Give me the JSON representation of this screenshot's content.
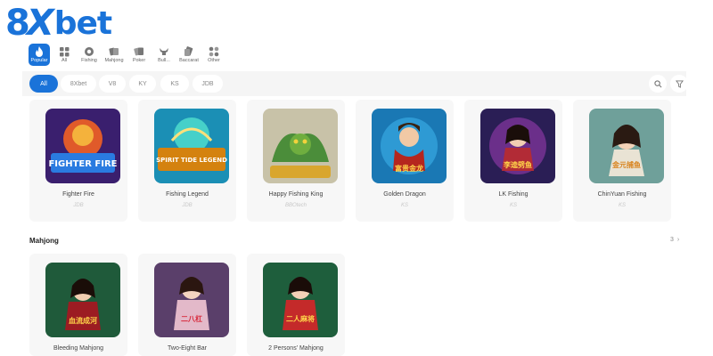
{
  "brand": {
    "logo_text_8": "8",
    "logo_text_x": "X",
    "logo_text_bet": "bet",
    "color": "#1a73d9"
  },
  "categories": [
    {
      "label": "Popular",
      "icon": "flame-icon",
      "active": true
    },
    {
      "label": "All",
      "icon": "grid-icon"
    },
    {
      "label": "Fishing",
      "icon": "fish-icon"
    },
    {
      "label": "Mahjong",
      "icon": "mahjong-icon"
    },
    {
      "label": "Poker",
      "icon": "cards-icon"
    },
    {
      "label": "Bull...",
      "icon": "bull-icon"
    },
    {
      "label": "Baccarat",
      "icon": "baccarat-icon"
    },
    {
      "label": "Other",
      "icon": "dots-icon"
    }
  ],
  "providers": [
    "All",
    "8Xbet",
    "V8",
    "KY",
    "KS",
    "JDB"
  ],
  "fishing_games": [
    {
      "name": "Fighter Fire",
      "provider": "JDB",
      "thumb_text": "FIGHTER FIRE"
    },
    {
      "name": "Fishing Legend",
      "provider": "JDB",
      "thumb_text": "SPIRIT TIDE LEGEND"
    },
    {
      "name": "Happy Fishing King",
      "provider": "BBOtech"
    },
    {
      "name": "Golden Dragon",
      "provider": "KS",
      "thumb_text": "富贵金龙"
    },
    {
      "name": "LK Fishing",
      "provider": "KS",
      "thumb_text": "李逵劈鱼"
    },
    {
      "name": "ChinYuan Fishing",
      "provider": "KS",
      "thumb_text": "金元捕鱼"
    }
  ],
  "mahjong_section": {
    "title": "Mahjong",
    "count": "3"
  },
  "mahjong_games": [
    {
      "name": "Bleeding Mahjong",
      "thumb_text": "血流成河"
    },
    {
      "name": "Two-Eight Bar",
      "thumb_text": "二八杠"
    },
    {
      "name": "2 Persons' Mahjong",
      "thumb_text": "二人麻将"
    }
  ]
}
